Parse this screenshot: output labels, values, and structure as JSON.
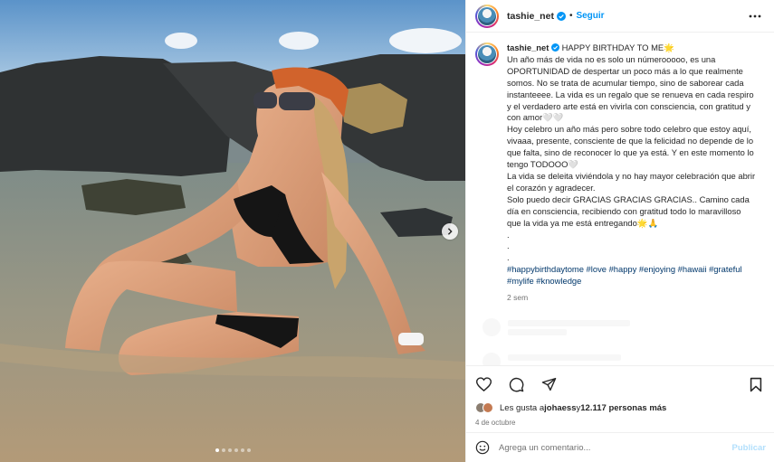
{
  "post": {
    "username": "tashie_net",
    "follow_label": "Seguir",
    "separator": "•",
    "verified_icon": "verified-badge-icon",
    "more_icon": "more-options-icon"
  },
  "caption": {
    "username": "tashie_net",
    "lines": [
      "HAPPY BIRTHDAY TO ME🌟",
      "Un año más de vida no es solo un númerooooo, es una OPORTUNIDAD de despertar un poco más a lo que realmente somos. No se trata de acumular tiempo, sino de saborear cada instanteeee. La vida es un regalo que se renueva en cada respiro y el verdadero arte está en vivirla con consciencia, con gratitud y con amor🤍🤍",
      "Hoy celebro un año más pero sobre todo celebro que estoy aquí, vivaaa, presente, consciente de que la felicidad no depende de lo que falta, sino de reconocer lo que ya está. Y en este momento lo tengo TODOOO🤍",
      "La vida se deleita viviéndola y no hay mayor celebración que abrir el corazón y agradecer.",
      "Solo puedo decir GRACIAS GRACIAS GRACIAS.. Camino cada día en consciencia, recibiendo con gratitud todo lo maravilloso que la vida ya me está entregando🌟🙏",
      ".",
      ".",
      "."
    ],
    "hashtags": "#happybirthdaytome #love #happy #enjoying #hawaii #grateful #mylife #knowledge",
    "time_ago": "2 sem"
  },
  "actions": {
    "like_icon": "heart-icon",
    "comment_icon": "comment-icon",
    "share_icon": "share-icon",
    "save_icon": "bookmark-icon"
  },
  "likes": {
    "prefix": "Les gusta a ",
    "user": "johaess",
    "middle": " y ",
    "count": "12.117 personas más"
  },
  "date": "4 de octubre",
  "comment": {
    "placeholder": "Agrega un comentario...",
    "publish_label": "Publicar",
    "emoji_icon": "emoji-icon"
  },
  "carousel": {
    "count": 6,
    "active_index": 0,
    "next_icon": "chevron-right-icon"
  },
  "colors": {
    "accent": "#0095f6",
    "link": "#00376b",
    "muted": "#737373",
    "publish_disabled": "#b2dffc"
  }
}
